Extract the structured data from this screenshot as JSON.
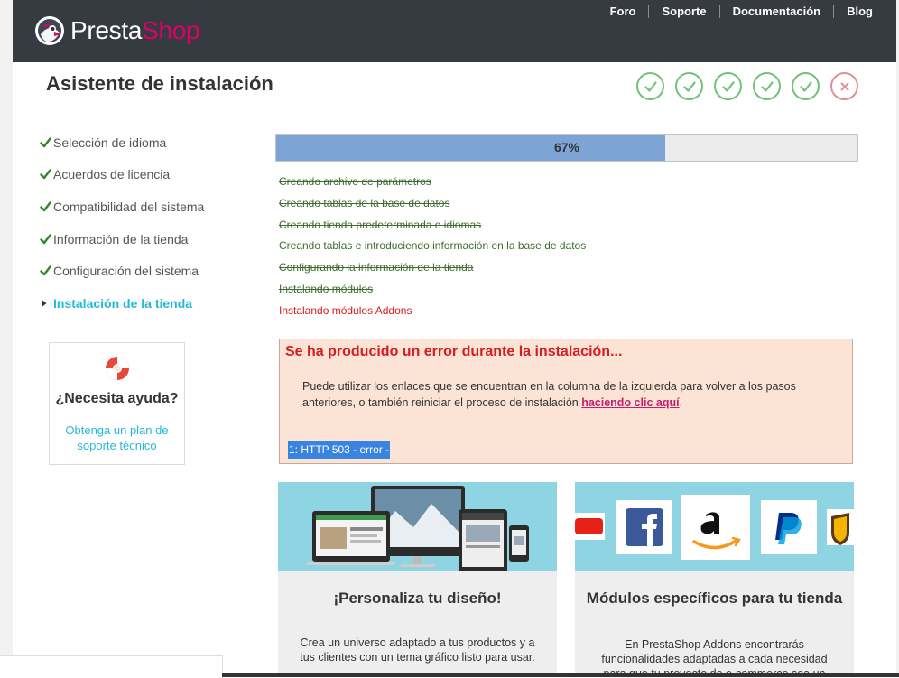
{
  "header": {
    "logo": {
      "part1": "Presta",
      "part2": "Shop"
    },
    "nav": [
      {
        "label": "Foro"
      },
      {
        "label": "Soporte"
      },
      {
        "label": "Documentación"
      },
      {
        "label": "Blog"
      }
    ]
  },
  "page_title": "Asistente de instalación",
  "step_indicators": [
    {
      "status": "done",
      "icon": "check-icon",
      "color": "#72c279"
    },
    {
      "status": "done",
      "icon": "check-icon",
      "color": "#72c279"
    },
    {
      "status": "done",
      "icon": "check-icon",
      "color": "#72c279"
    },
    {
      "status": "done",
      "icon": "check-icon",
      "color": "#72c279"
    },
    {
      "status": "done",
      "icon": "check-icon",
      "color": "#72c279"
    },
    {
      "status": "error",
      "icon": "close-icon",
      "color": "#e08f95"
    }
  ],
  "sidebar": {
    "items": [
      {
        "label": "Selección de idioma",
        "status": "done"
      },
      {
        "label": "Acuerdos de licencia",
        "status": "done"
      },
      {
        "label": "Compatibilidad del sistema",
        "status": "done"
      },
      {
        "label": "Información de la tienda",
        "status": "done"
      },
      {
        "label": "Configuración del sistema",
        "status": "done"
      },
      {
        "label": "Instalación de la tienda",
        "status": "active"
      }
    ]
  },
  "help": {
    "title": "¿Necesita ayuda?",
    "link": "Obtenga un plan de soporte técnico"
  },
  "progress": {
    "value": 0.67,
    "label": "67%"
  },
  "log": [
    {
      "text": "Creando archivo de parámetros",
      "status": "done"
    },
    {
      "text": "Creando tablas de la base de datos",
      "status": "done"
    },
    {
      "text": "Creando tienda predeterminada e idiomas",
      "status": "done"
    },
    {
      "text": "Creando tablas e introduciendo información en la base de datos",
      "status": "done"
    },
    {
      "text": "Configurando la información de la tienda",
      "status": "done"
    },
    {
      "text": "Instalando módulos",
      "status": "done"
    },
    {
      "text": "Instalando módulos Addons",
      "status": "failed"
    }
  ],
  "error": {
    "title": "Se ha producido un error durante la instalación...",
    "message_before": "Puede utilizar los enlaces que se encuentran en la columna de la izquierda para volver a los pasos anteriores, o también reiniciar el proceso de instalación ",
    "link": "haciendo clic aquí",
    "message_after": ".",
    "detail": "1: HTTP 503 - error -"
  },
  "promos": [
    {
      "title": "¡Personaliza tu diseño!",
      "text": "Crea un universo adaptado a tus productos y a tus clientes con un tema gráfico listo para usar."
    },
    {
      "title": "Módulos específicos para tu tienda",
      "text": "En PrestaShop Addons encontrarás funcionalidades adaptadas a cada necesidad para que tu proyecto de e-commerce sea un",
      "logos": [
        "YouTube",
        "Facebook",
        "Amazon",
        "PayPal",
        "UPS"
      ]
    }
  ],
  "colors": {
    "header_bg": "#363a41",
    "accent": "#25b9d7",
    "brand_pink": "#df0067",
    "done_green": "#72c279",
    "error_red": "#d91c1c",
    "progress_fill": "#7ca5d6"
  }
}
